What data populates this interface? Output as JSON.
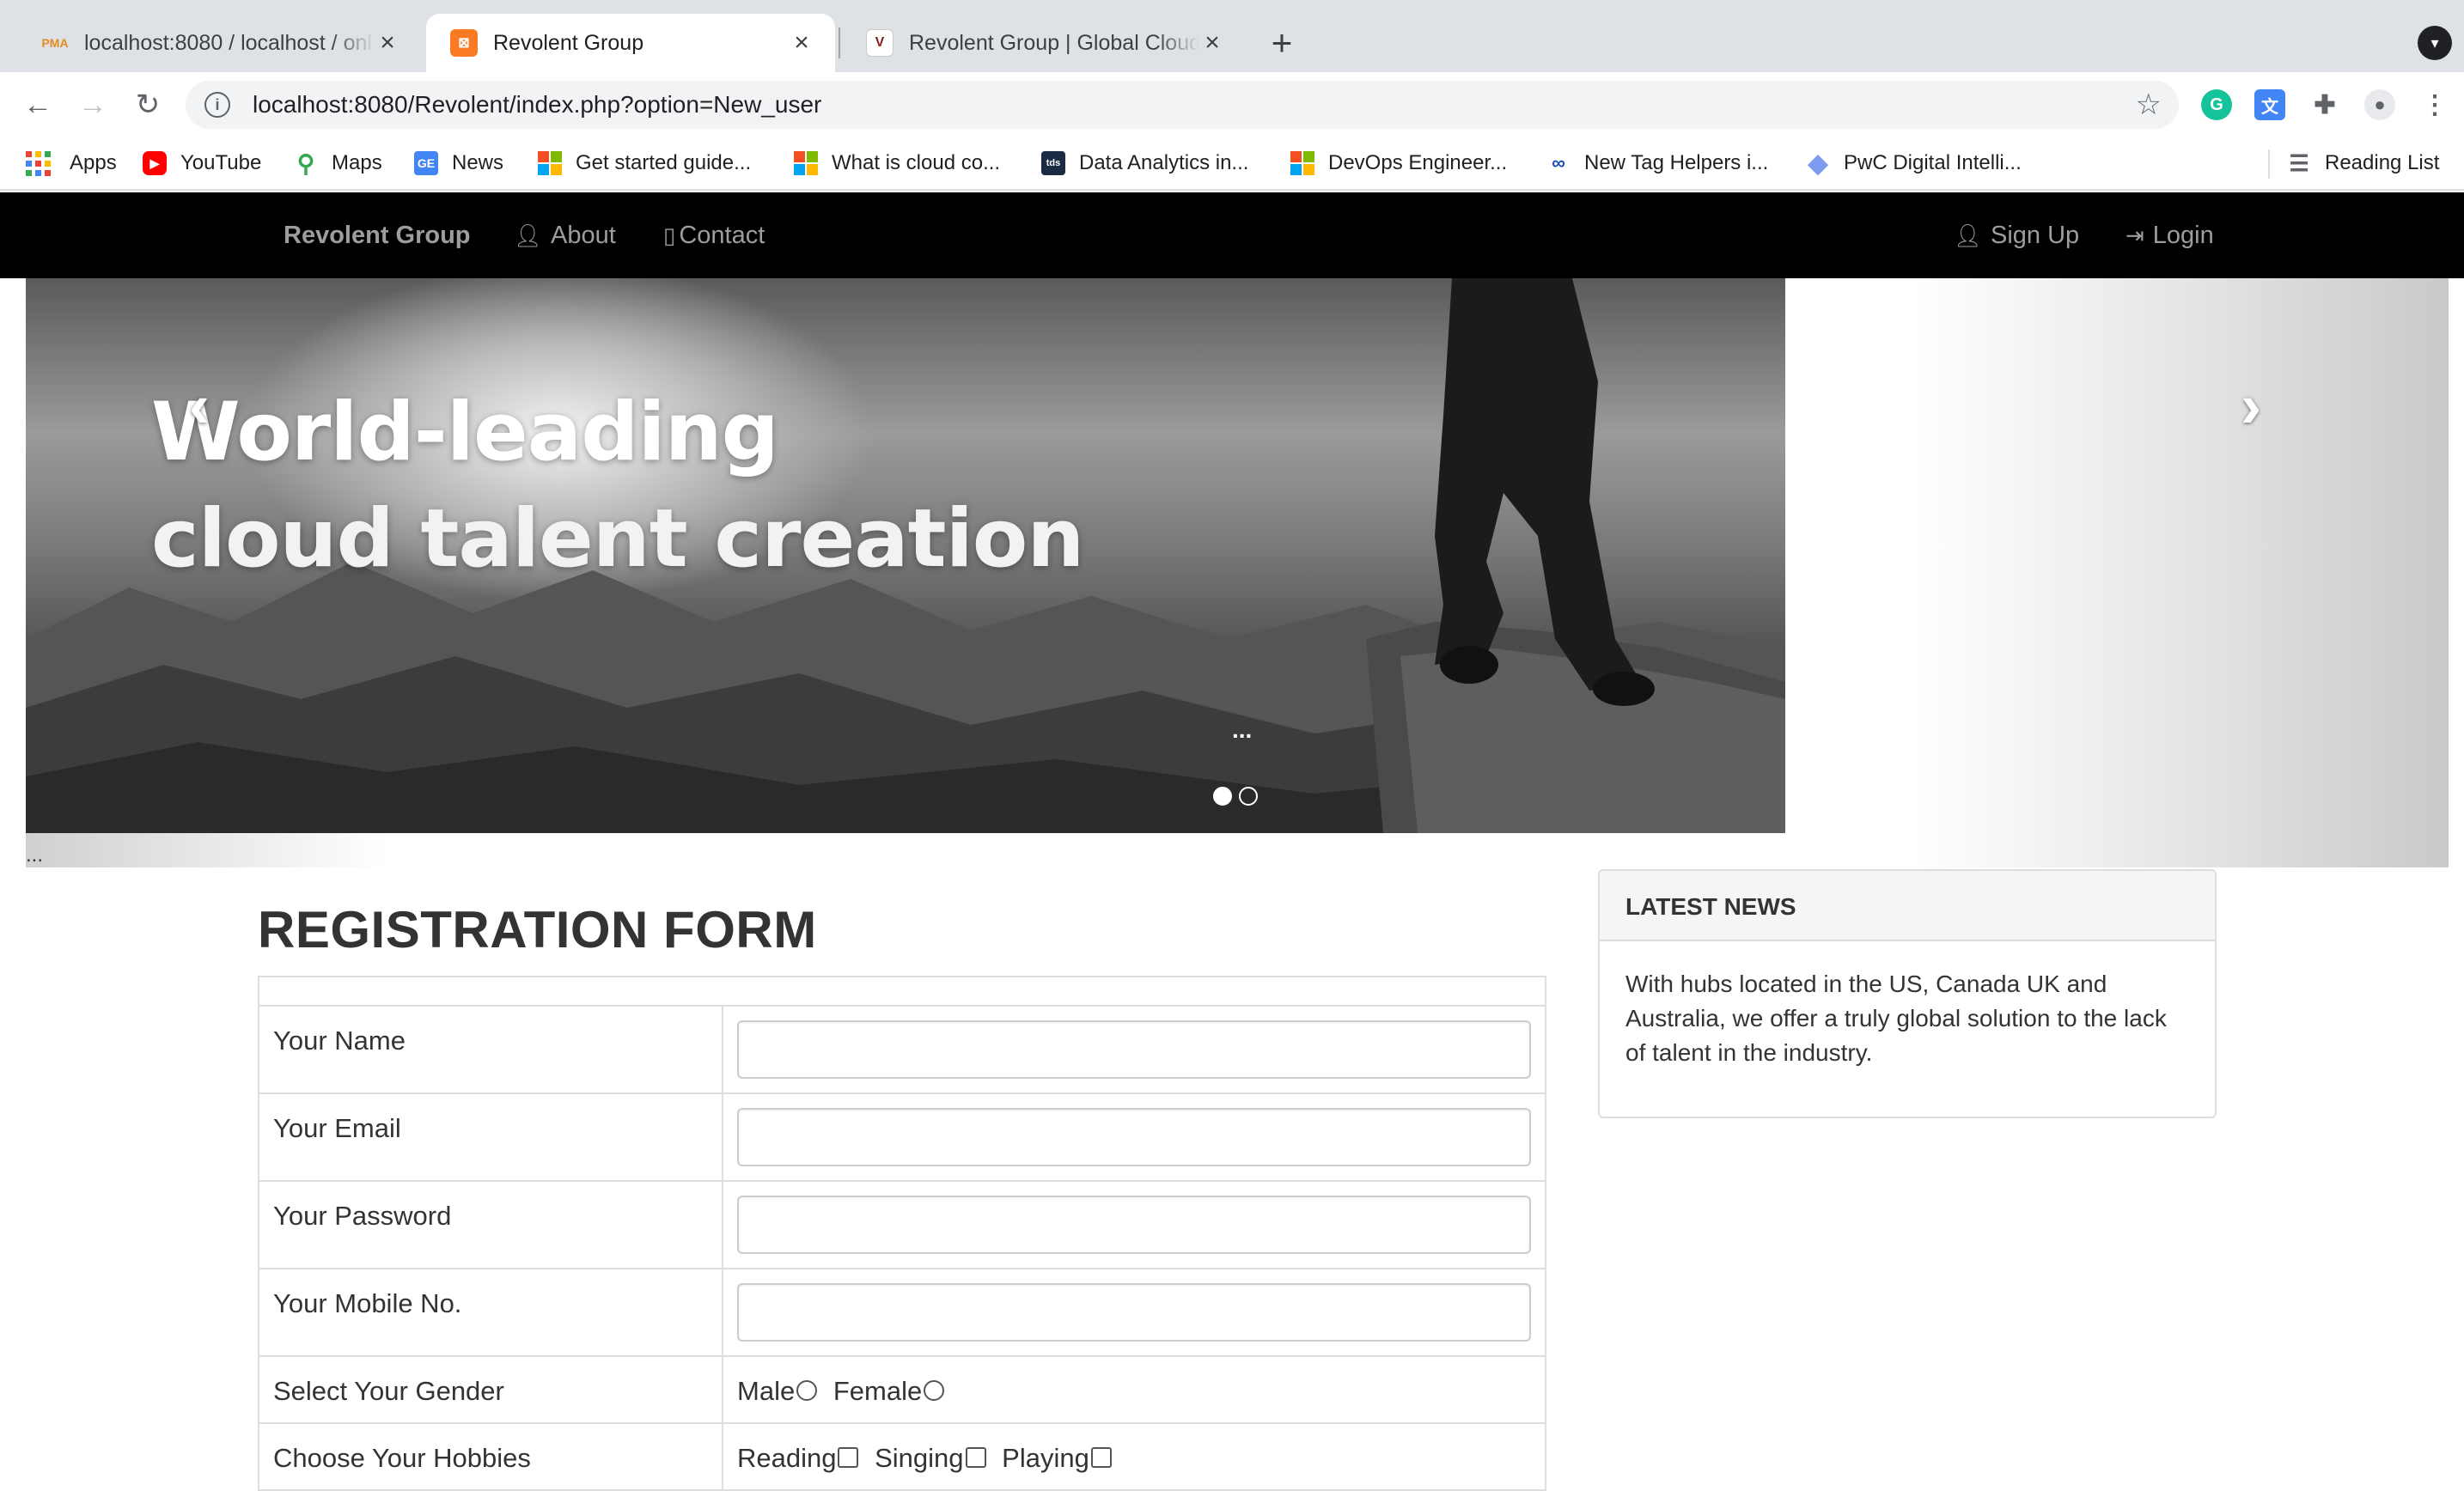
{
  "browser": {
    "tabs": [
      {
        "title": "localhost:8080 / localhost / onl",
        "favicon": "phpmyadmin-icon"
      },
      {
        "title": "Revolent Group",
        "favicon": "xampp-icon"
      },
      {
        "title": "Revolent Group | Global Cloud",
        "favicon": "revolent-icon"
      }
    ],
    "url": "localhost:8080/Revolent/index.php?option=New_user",
    "bookmarks": [
      {
        "label": "Apps"
      },
      {
        "label": "YouTube"
      },
      {
        "label": "Maps"
      },
      {
        "label": "News"
      },
      {
        "label": "Get started guide..."
      },
      {
        "label": "What is cloud co..."
      },
      {
        "label": "Data Analytics in..."
      },
      {
        "label": "DevOps Engineer..."
      },
      {
        "label": "New Tag Helpers i..."
      },
      {
        "label": "PwC Digital Intelli..."
      }
    ],
    "reading_list": "Reading List"
  },
  "navbar": {
    "brand": "Revolent Group",
    "about": "About",
    "contact": "Contact",
    "signup": "Sign Up",
    "login": "Login"
  },
  "carousel": {
    "line1": "World-leading",
    "line2": "cloud talent creation",
    "caption": "...",
    "below": "...",
    "active_slide": 1,
    "slide_count": 2
  },
  "form": {
    "title": "REGISTRATION FORM",
    "name_label": "Your Name",
    "email_label": "Your Email",
    "password_label": "Your Password",
    "mobile_label": "Your Mobile No.",
    "gender_label": "Select Your Gender",
    "gender_options": [
      "Male",
      "Female"
    ],
    "hobbies_label": "Choose Your Hobbies",
    "hobby_options": [
      "Reading",
      "Singing",
      "Playing"
    ]
  },
  "news": {
    "heading": "LATEST NEWS",
    "body": "With hubs located in the US, Canada UK and Australia, we offer a truly global solution to the lack of talent in the industry."
  }
}
